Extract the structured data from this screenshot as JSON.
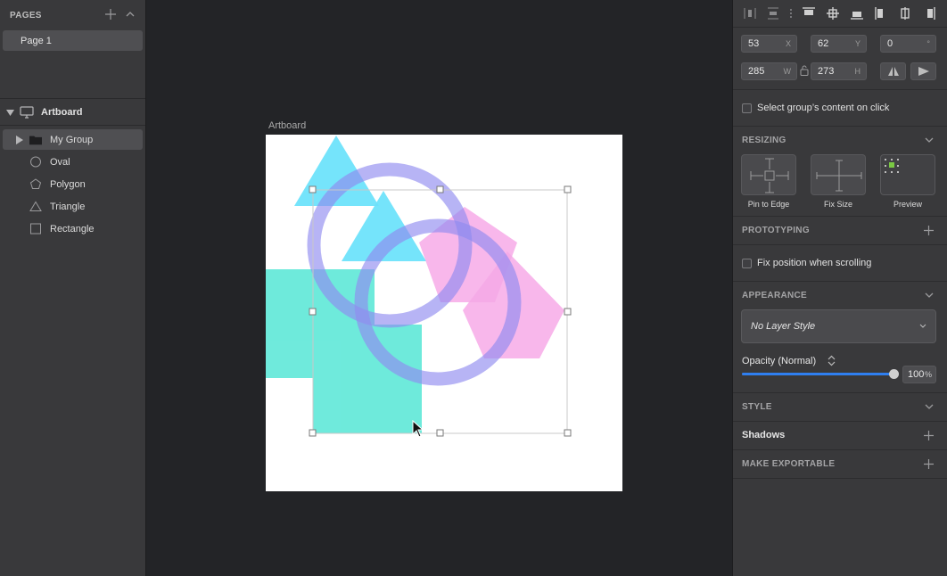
{
  "sidebar": {
    "pages_title": "PAGES",
    "pages": [
      {
        "label": "Page 1",
        "selected": true
      }
    ],
    "artboard_label": "Artboard",
    "layers": [
      {
        "label": "My Group",
        "icon": "folder-icon",
        "selected": true,
        "expandable": true
      },
      {
        "label": "Oval",
        "icon": "oval-icon",
        "selected": false,
        "expandable": false
      },
      {
        "label": "Polygon",
        "icon": "polygon-icon",
        "selected": false,
        "expandable": false
      },
      {
        "label": "Triangle",
        "icon": "triangle-icon",
        "selected": false,
        "expandable": false
      },
      {
        "label": "Rectangle",
        "icon": "rectangle-icon",
        "selected": false,
        "expandable": false
      }
    ]
  },
  "canvas": {
    "artboard_title": "Artboard",
    "colors": {
      "artboard": "#ffffff",
      "triangle": "#66e0fb",
      "rectangle": "#67e9da",
      "polygon": "#f6a6e6",
      "oval": "#8a86f0",
      "selection": "#c8c8c8"
    }
  },
  "inspector": {
    "x": {
      "value": "53",
      "unit": "X"
    },
    "y": {
      "value": "62",
      "unit": "Y"
    },
    "rotation": {
      "value": "0",
      "unit": "°"
    },
    "w": {
      "value": "285",
      "unit": "W"
    },
    "h": {
      "value": "273",
      "unit": "H"
    },
    "select_content_label": "Select group’s content on click",
    "resizing": {
      "title": "RESIZING",
      "options": [
        "Pin to Edge",
        "Fix Size",
        "Preview"
      ]
    },
    "prototyping": {
      "title": "PROTOTYPING",
      "fix_position_label": "Fix position when scrolling"
    },
    "appearance": {
      "title": "APPEARANCE",
      "layer_style": "No Layer Style",
      "opacity_label": "Opacity (Normal)",
      "opacity_value": "100",
      "opacity_unit": "%",
      "opacity_fraction": 1.0
    },
    "style_title": "STYLE",
    "shadows_title": "Shadows",
    "exportable_title": "MAKE EXPORTABLE",
    "accent": "#2f7ff0"
  }
}
